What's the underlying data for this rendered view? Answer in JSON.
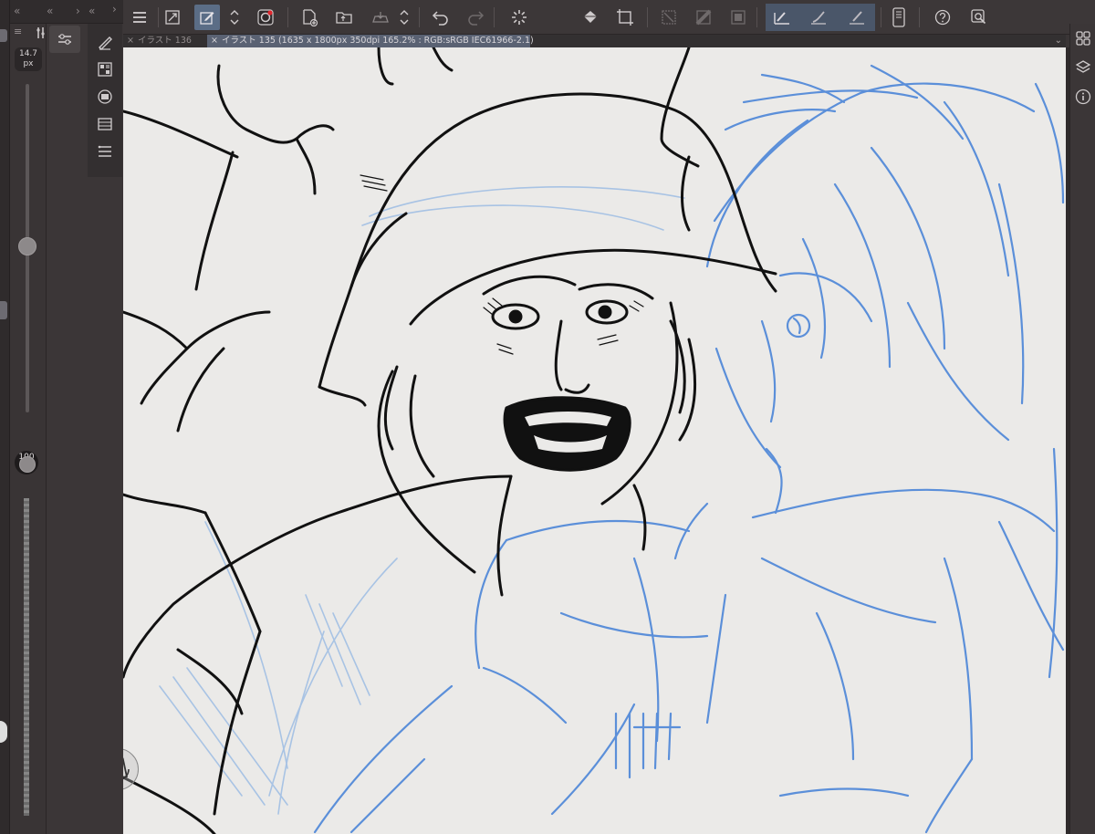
{
  "app": {
    "tabs": [
      {
        "close": "×",
        "label": "イラスト 136"
      },
      {
        "close": "×",
        "label": "イラスト 135 (1635 x 1800px 350dpi 165.2% : RGB:sRGB IEC61966-2.1)"
      }
    ],
    "brush_size": {
      "value": "14.7",
      "unit": "px"
    },
    "opacity": {
      "value": "100",
      "unit": "%"
    },
    "left_header": {
      "collapse": "«",
      "collapse2": "«",
      "chev": "›",
      "collapse3": "«"
    },
    "menu_glyph": "≡",
    "tab_overflow": "⌄"
  },
  "toolbar_icons": [
    "menu-icon",
    "fit-window-icon",
    "edit-icon",
    "stepper-icon",
    "color-wheel-icon",
    "new-canvas-icon",
    "open-folder-icon",
    "save-icon",
    "stepper-icon",
    "undo-icon",
    "redo-icon",
    "loading-icon",
    "fill-icon",
    "crop-icon",
    "clear-icon",
    "fill-pattern-icon",
    "frame-icon",
    "stroke-a-icon",
    "stroke-b-icon",
    "stroke-c-icon",
    "device-icon",
    "help-icon",
    "search-icon"
  ],
  "colors": {
    "ink": "#111111",
    "blue_sketch": "#5b8fd9",
    "light_blue": "#a8c3e4",
    "canvas_bg": "#ebeae8",
    "active_tab": "#5a6273"
  }
}
